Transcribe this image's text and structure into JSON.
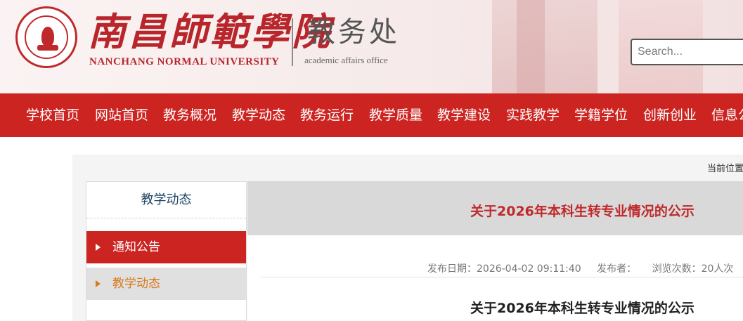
{
  "header": {
    "logo_icon": "school-seal-icon",
    "school_name_cn": "南昌師範學院",
    "school_name_en": "NANCHANG NORMAL UNIVERSITY",
    "office_name_cn": "教务处",
    "office_name_en": "academic affairs office",
    "search": {
      "placeholder": "Search..."
    }
  },
  "nav": {
    "items": [
      {
        "label": "学校首页"
      },
      {
        "label": "网站首页"
      },
      {
        "label": "教务概况"
      },
      {
        "label": "教学动态"
      },
      {
        "label": "教务运行"
      },
      {
        "label": "教学质量"
      },
      {
        "label": "教学建设"
      },
      {
        "label": "实践教学"
      },
      {
        "label": "学籍学位"
      },
      {
        "label": "创新创业"
      },
      {
        "label": "信息公"
      }
    ]
  },
  "breadcrumb": {
    "label": "当前位置"
  },
  "sidebar": {
    "title": "教学动态",
    "items": [
      {
        "label": "通知公告",
        "icon": "triangle-right-icon"
      },
      {
        "label": "教学动态",
        "icon": "triangle-right-icon"
      }
    ]
  },
  "article": {
    "title": "关于2026年本科生转专业情况的公示",
    "publish_date": "发布日期：2026-04-02 09:11:40",
    "publisher": "发布者：",
    "views": "浏览次数：20人次",
    "body_title": "关于2026年本科生转专业情况的公示"
  },
  "colors": {
    "brand_red": "#cc2421",
    "accent_orange": "#d97a1c",
    "title_red": "#c0292b"
  }
}
